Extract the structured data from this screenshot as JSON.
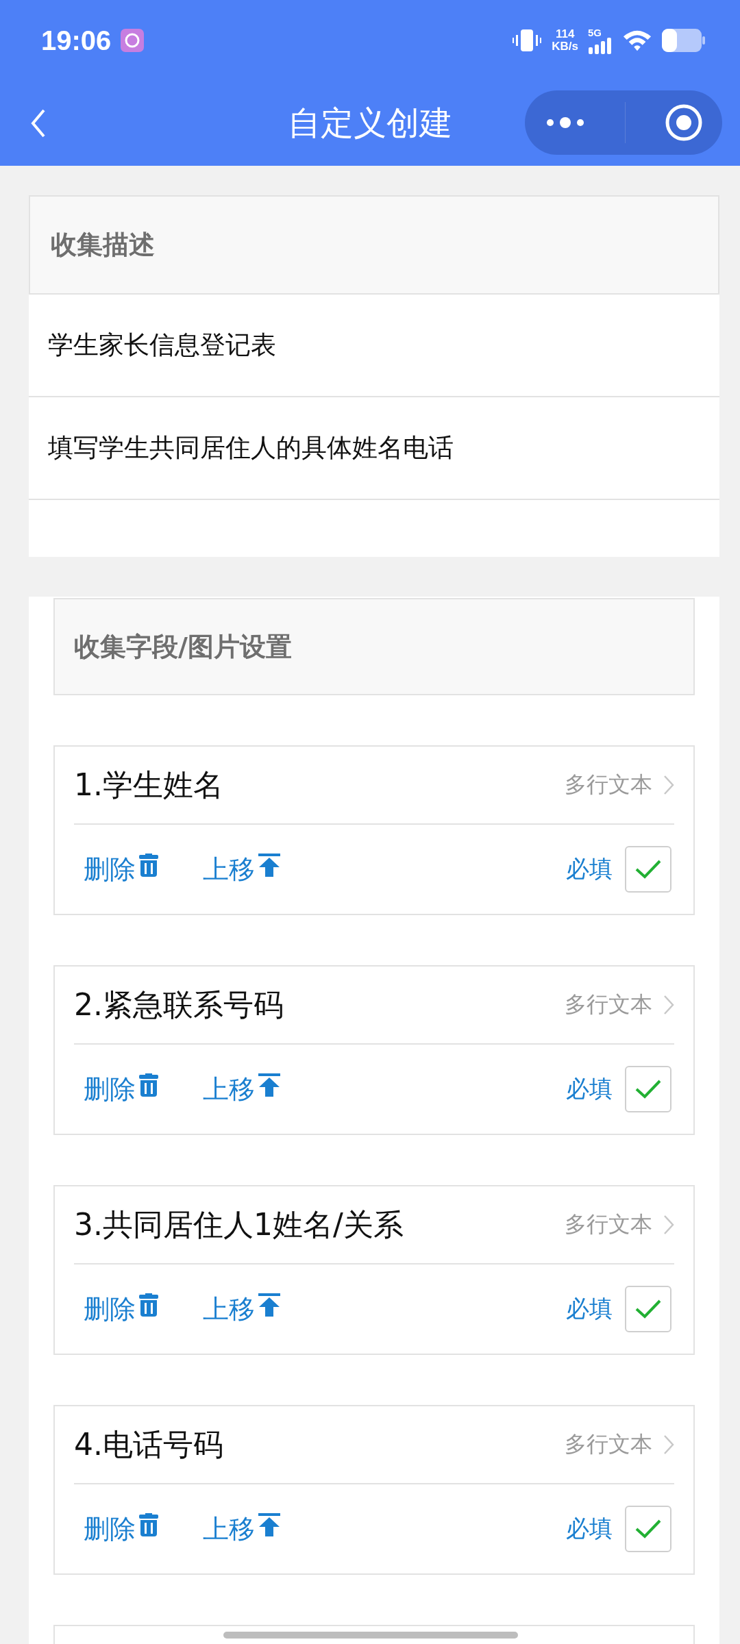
{
  "status_bar": {
    "time": "19:06",
    "speed_value": "114",
    "speed_unit": "KB/s",
    "network": "5G"
  },
  "header": {
    "title": "自定义创建"
  },
  "description": {
    "title": "收集描述",
    "rows": [
      "学生家长信息登记表",
      "填写学生共同居住人的具体姓名电话"
    ]
  },
  "fields_section": {
    "title": "收集字段/图片设置",
    "fields": [
      {
        "name": "1.学生姓名",
        "type": "多行文本",
        "delete": "删除",
        "move_up": "上移",
        "required_label": "必填",
        "required": true
      },
      {
        "name": "2.紧急联系号码",
        "type": "多行文本",
        "delete": "删除",
        "move_up": "上移",
        "required_label": "必填",
        "required": true
      },
      {
        "name": "3.共同居住人1姓名/关系",
        "type": "多行文本",
        "delete": "删除",
        "move_up": "上移",
        "required_label": "必填",
        "required": true
      },
      {
        "name": "4.电话号码",
        "type": "多行文本",
        "delete": "删除",
        "move_up": "上移",
        "required_label": "必填",
        "required": true
      }
    ]
  }
}
